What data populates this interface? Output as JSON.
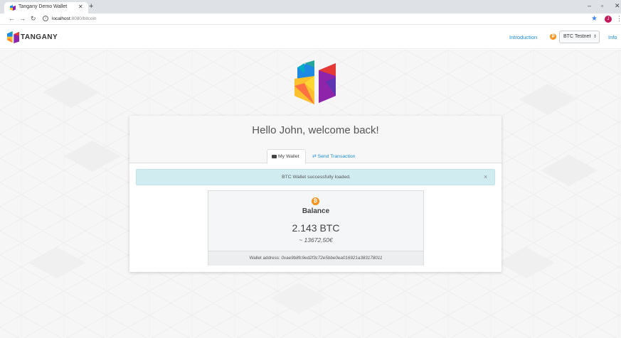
{
  "browser": {
    "tab_title": "Tangany Demo Wallet",
    "url_host": "localhost",
    "url_path": ":8080/bitcoin",
    "profile_initial": "J",
    "icons": [
      "back-arrow-icon",
      "forward-arrow-icon",
      "reload-icon",
      "info-icon",
      "star-icon",
      "kebab-icon",
      "close-icon",
      "plus-icon"
    ]
  },
  "navbar": {
    "brand": "TANGANY",
    "introduction": "Introduction",
    "network_coin": "₿",
    "network": "BTC Testnet",
    "info": "Info"
  },
  "card": {
    "greeting": "Hello John, welcome back!",
    "tab_wallet": "My Wallet",
    "tab_send": "Send Transaction",
    "alert": "BTC Wallet successfully loaded.",
    "alert_close": "×",
    "coin_symbol": "₿",
    "balance_label": "Balance",
    "balance_value": "2.143 BTC",
    "balance_eur": "~ 13672,50€",
    "address_label": "Wallet address:",
    "address": "0xae9b8fc9ed2f3c72e5bbe0ea016921a383178011"
  },
  "colors": {
    "brand_blue": "#1a8cd8",
    "btc_orange": "#f7931a",
    "alert_bg": "#d1ecf1"
  }
}
